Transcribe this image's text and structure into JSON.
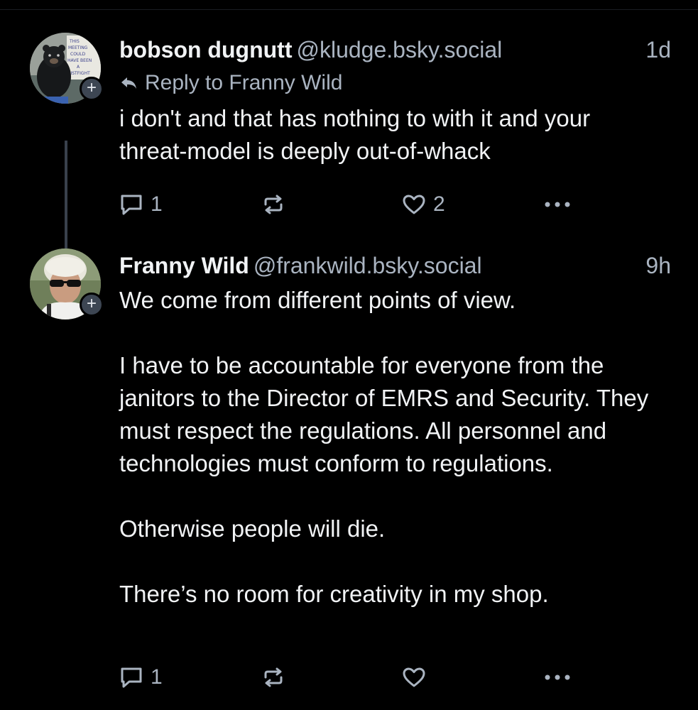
{
  "posts": [
    {
      "author_name": "bobson dugnutt",
      "handle": "@kludge.bsky.social",
      "time": "1d",
      "reply_to": "Reply to Franny Wild",
      "avatar_sign_text": [
        "THIS",
        "MEETING",
        "COULD",
        "HAVE BEEN",
        "A",
        "FISTFIGHT"
      ],
      "paragraphs": [
        "i don't and that has nothing to with it and your threat-model is deeply out-of-whack"
      ],
      "reply_count": "1",
      "repost_count": "",
      "like_count": "2"
    },
    {
      "author_name": "Franny Wild",
      "handle": "@frankwild.bsky.social",
      "time": "9h",
      "paragraphs": [
        "We come from different points of view.",
        "I have to be accountable for everyone from the janitors to the Director of EMRS and Security. They must respect the regulations. All personnel and technologies must conform to regulations.",
        "Otherwise people will die.",
        "There’s no room for creativity in my shop."
      ],
      "reply_count": "1",
      "repost_count": "",
      "like_count": ""
    }
  ],
  "icons": {
    "follow": "plus-icon",
    "reply_arrow": "reply-arrow-icon",
    "reply": "speech-bubble-icon",
    "repost": "repost-arrows-icon",
    "like": "heart-icon",
    "more": "ellipsis-icon"
  },
  "colors": {
    "background": "#000000",
    "text": "#f1f3f5",
    "muted": "#aab4c1",
    "thread_line": "#39414c",
    "badge": "#3d4653"
  },
  "plus_glyph": "+"
}
